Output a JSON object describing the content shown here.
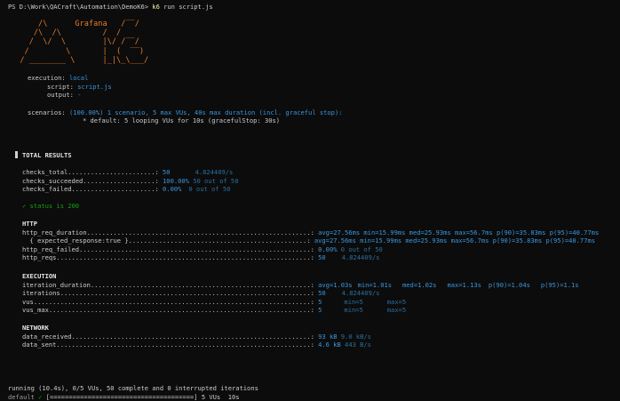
{
  "prompt": {
    "path": "PS D:\\Work\\QACraft\\Automation\\DemoK6> ",
    "command": "k6",
    "args": " run script.js"
  },
  "banner": {
    "logo_text": "Grafana",
    "art": "      /\\      Grafana   /‾‾/  \n     /\\  /\\         /  /   \n    /  \\/  \\        |\\/ /‾‾/\n   /        \\       |  (  ‾‾)\n  / ________ \\      |_|\\_\\___/"
  },
  "execution": {
    "execution_label": "execution:",
    "execution_value": "local",
    "script_label": "script:",
    "script_value": "script.js",
    "output_label": "output:",
    "output_value": "-"
  },
  "scenarios": {
    "label": "scenarios:",
    "summary": "(100.00%) 1 scenario, 5 max VUs, 40s max duration (incl. graceful stop):",
    "detail": "* default: 5 looping VUs for 10s (gracefulStop: 30s)"
  },
  "results_title": "TOTAL RESULTS",
  "checks": {
    "total": {
      "label": "checks_total.......................:",
      "value": "50",
      "rate": "4.824409/s"
    },
    "succeeded": {
      "label": "checks_succeeded...................:",
      "value": "100.00%",
      "rate": "50 out of 50"
    },
    "failed": {
      "label": "checks_failed......................:",
      "value": "0.00%",
      "rate": "0 out of 50"
    }
  },
  "check_status": {
    "mark": "✓",
    "text": " status is 200"
  },
  "http": {
    "header": "HTTP",
    "req_duration": {
      "label": "http_req_duration...........................................................:",
      "avg": "avg=27.56ms",
      "min": "min=15.99ms",
      "med": "med=25.93ms",
      "max": "max=56.7ms",
      "p90": "p(90)=35.83ms",
      "p95": "p(95)=40.77ms"
    },
    "expected_response": {
      "label": "  { expected_response:true }...............................................:",
      "avg": "avg=27.56ms",
      "min": "min=15.99ms",
      "med": "med=25.93ms",
      "max": "max=56.7ms",
      "p90": "p(90)=35.83ms",
      "p95": "p(95)=40.77ms"
    },
    "req_failed": {
      "label": "http_req_failed.............................................................:",
      "value": "0.00%",
      "rate": "0 out of 50"
    },
    "reqs": {
      "label": "http_reqs...................................................................:",
      "value": "50",
      "rate": "4.824409/s"
    }
  },
  "execution_section": {
    "header": "EXECUTION",
    "iteration_duration": {
      "label": "iteration_duration..........................................................:",
      "avg": "avg=1.03s",
      "min": "min=1.01s",
      "med": "med=1.02s",
      "max": "max=1.13s",
      "p90": "p(90)=1.04s",
      "p95": "p(95)=1.1s"
    },
    "iterations": {
      "label": "iterations..................................................................:",
      "value": "50",
      "rate": "4.824409/s"
    },
    "vus": {
      "label": "vus.........................................................................:",
      "value": "5",
      "min": "min=5",
      "max": "max=5"
    },
    "vus_max": {
      "label": "vus_max.....................................................................:",
      "value": "5",
      "min": "min=5",
      "max": "max=5"
    }
  },
  "network": {
    "header": "NETWORK",
    "received": {
      "label": "data_received...............................................................:",
      "value": "93 kB",
      "rate": "9.0 kB/s"
    },
    "sent": {
      "label": "data_sent...................................................................:",
      "value": "4.6 kB",
      "rate": "443 B/s"
    }
  },
  "footer": {
    "running": "running (10.4s), 0/5 VUs, 50 complete and 0 interrupted iterations",
    "scenario": "default ",
    "mark": "✓",
    "progress_bar": " [======================================]",
    "progress_text": " 5 VUs  10s",
    "progress_fraction": 1.0
  }
}
